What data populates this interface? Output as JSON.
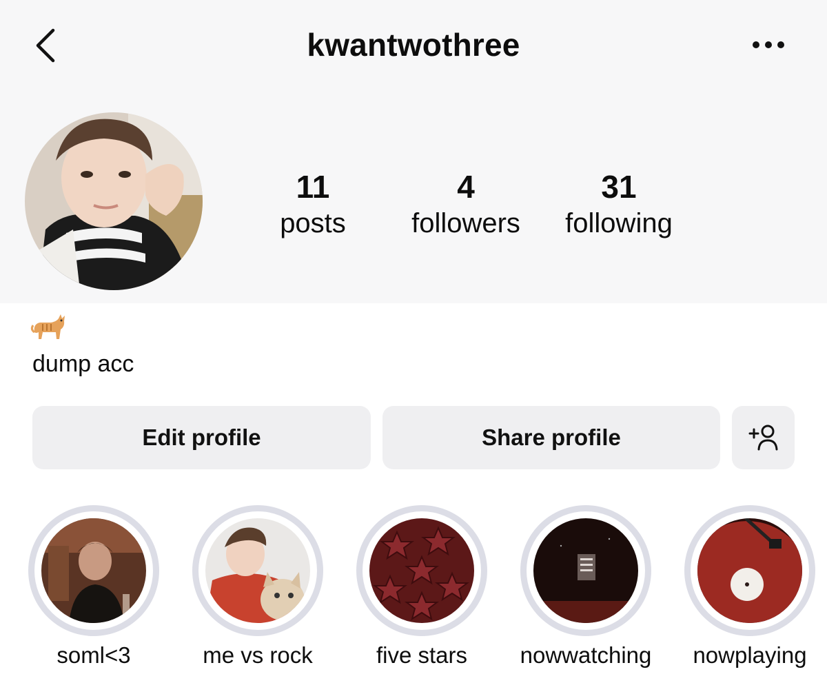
{
  "header": {
    "username": "kwantwothree",
    "back_icon": "chevron-left-icon",
    "more_icon": "more-horizontal-icon"
  },
  "stats": {
    "posts_count": "11",
    "posts_label": "posts",
    "followers_count": "4",
    "followers_label": "followers",
    "following_count": "31",
    "following_label": "following"
  },
  "bio": {
    "emoji": "🐈",
    "text": "dump acc"
  },
  "actions": {
    "edit_label": "Edit profile",
    "share_label": "Share profile",
    "add_person_icon": "add-person-icon"
  },
  "highlights": [
    {
      "label": "soml<3"
    },
    {
      "label": "me vs rock"
    },
    {
      "label": "five stars"
    },
    {
      "label": "nowwatching"
    },
    {
      "label": "nowplaying"
    }
  ],
  "colors": {
    "header_bg": "#f7f7f8",
    "button_bg": "#efeff1",
    "highlight_ring": "#dcdde6",
    "text": "#0d0d0d"
  }
}
